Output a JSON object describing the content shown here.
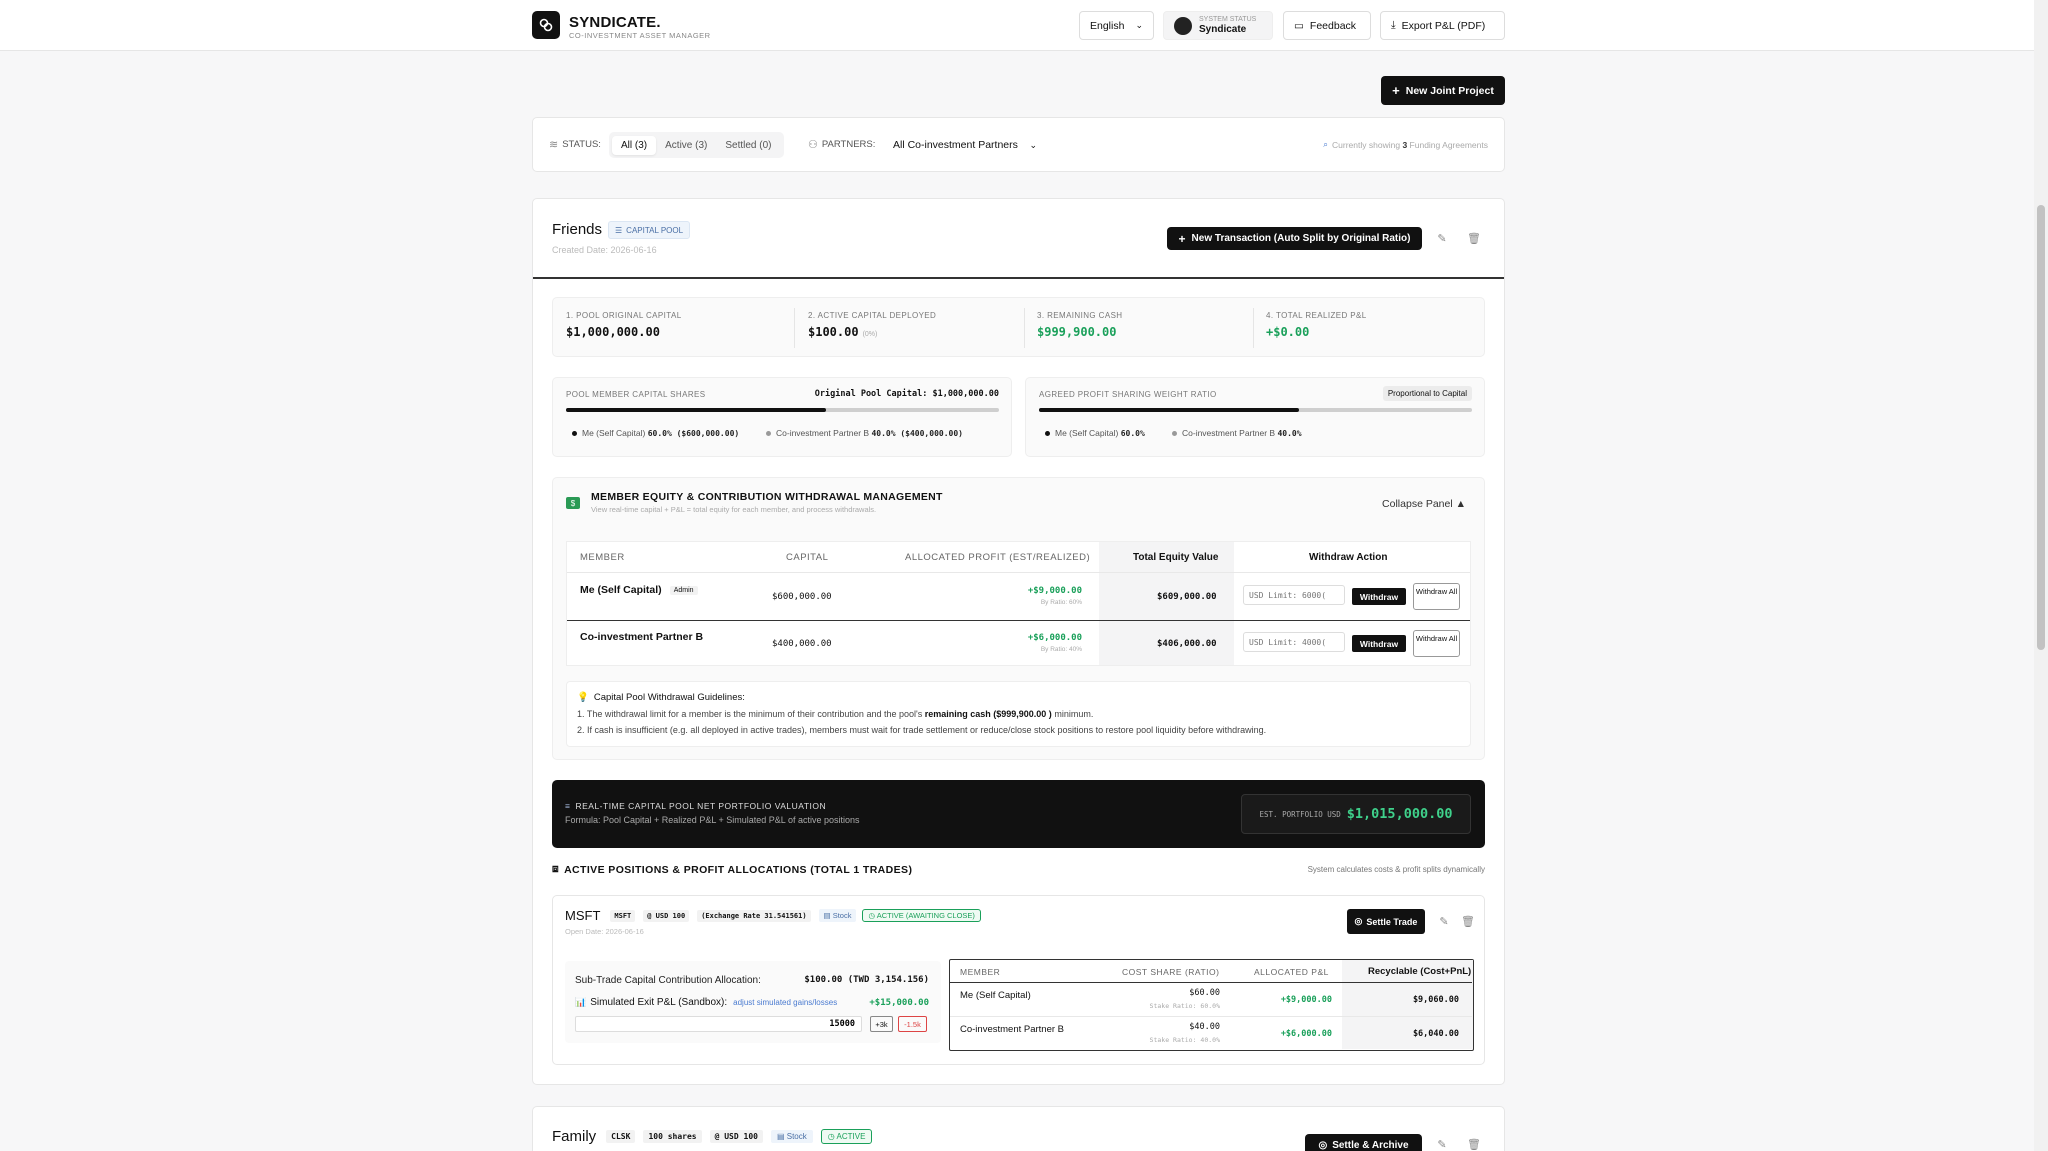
{
  "header": {
    "brand": "SYNDICATE.",
    "brand_sub": "CO-INVESTMENT ASSET MANAGER",
    "language": "English",
    "system_status_label": "SYSTEM STATUS",
    "system_status_value": "Syndicate",
    "feedback": "Feedback",
    "export": "Export P&L (PDF)"
  },
  "actions": {
    "new_project": "New Joint Project"
  },
  "filters": {
    "status_label": "STATUS:",
    "tabs": [
      "All (3)",
      "Active (3)",
      "Settled (0)"
    ],
    "partners_label": "PARTNERS:",
    "partners_value": "All Co-investment Partners",
    "showing_prefix": "Currently showing",
    "showing_count": "3",
    "showing_suffix": "Funding Agreements"
  },
  "friends": {
    "title": "Friends",
    "badge": "CAPITAL POOL",
    "created": "Created Date: 2026-06-16",
    "new_tx": "New Transaction (Auto Split by Original Ratio)",
    "stats": [
      {
        "label": "1. POOL ORIGINAL CAPITAL",
        "value": "$1,000,000.00",
        "note": ""
      },
      {
        "label": "2. ACTIVE CAPITAL DEPLOYED",
        "value": "$100.00",
        "note": "(0%)"
      },
      {
        "label": "3. REMAINING CASH",
        "value": "$999,900.00",
        "note": ""
      },
      {
        "label": "4. TOTAL REALIZED P&L",
        "value": "+$0.00",
        "note": ""
      }
    ],
    "shares": {
      "title": "POOL MEMBER CAPITAL SHARES",
      "original": "Original Pool Capital: $1,000,000.00",
      "fill": 0.6,
      "items": [
        {
          "name": "Me (Self Capital)",
          "value": "60.0% ($600,000.00)"
        },
        {
          "name": "Co-investment Partner B",
          "value": "40.0% ($400,000.00)"
        }
      ]
    },
    "weights": {
      "title": "AGREED PROFIT SHARING WEIGHT RATIO",
      "badge": "Proportional to Capital",
      "fill": 0.6,
      "items": [
        {
          "name": "Me (Self Capital)",
          "value": "60.0%"
        },
        {
          "name": "Co-investment Partner B",
          "value": "40.0%"
        }
      ]
    },
    "equity": {
      "title": "MEMBER EQUITY & CONTRIBUTION WITHDRAWAL MANAGEMENT",
      "subtitle": "View real-time capital + P&L = total equity for each member, and process withdrawals.",
      "collapse": "Collapse Panel ▲",
      "headers": [
        "MEMBER",
        "CAPITAL",
        "ALLOCATED PROFIT (EST/REALIZED)",
        "Total Equity Value",
        "Withdraw Action"
      ],
      "rows": [
        {
          "member": "Me (Self Capital)",
          "tag": "Admin",
          "capital": "$600,000.00",
          "profit": "+$9,000.00",
          "ratio": "By Ratio: 60%",
          "equity": "$609,000.00",
          "placeholder": "USD Limit: 6000(",
          "withdraw": "Withdraw",
          "withdraw_all": "Withdraw All"
        },
        {
          "member": "Co-investment Partner B",
          "tag": "",
          "capital": "$400,000.00",
          "profit": "+$6,000.00",
          "ratio": "By Ratio: 40%",
          "equity": "$406,000.00",
          "placeholder": "USD Limit: 4000(",
          "withdraw": "Withdraw",
          "withdraw_all": "Withdraw All"
        }
      ],
      "guidelines_title": "Capital Pool Withdrawal Guidelines:",
      "g1_a": "1. The withdrawal limit for a member is the minimum of their contribution and the pool's",
      "g1_b": "remaining cash ($999,900.00 )",
      "g1_c": "minimum.",
      "g2": "2. If cash is insufficient (e.g. all deployed in active trades), members must wait for trade settlement or reduce/close stock positions to restore pool liquidity before withdrawing."
    },
    "valuation": {
      "title": "REAL-TIME CAPITAL POOL NET PORTFOLIO VALUATION",
      "formula": "Formula: Pool Capital + Realized P&L + Simulated P&L of active positions",
      "est_label": "EST. PORTFOLIO USD",
      "est_value": "$1,015,000.00"
    },
    "positions": {
      "title": "ACTIVE POSITIONS & PROFIT ALLOCATIONS (TOTAL 1 TRADES)",
      "note": "System calculates costs & profit splits dynamically",
      "trade": {
        "ticker": "MSFT",
        "tag_ticker": "MSFT",
        "price": "@ USD 100",
        "rate": "(Exchange Rate 31.541561)",
        "type": "Stock",
        "status": "ACTIVE (AWAITING CLOSE)",
        "open_date": "Open Date: 2026-06-16",
        "settle": "Settle Trade",
        "alloc_label": "Sub-Trade Capital Contribution Allocation:",
        "alloc_value": "$100.00 (TWD 3,154.156)",
        "sim_label": "Simulated Exit P&L (Sandbox):",
        "sim_link": "adjust simulated gains/losses",
        "sim_value": "+$15,000.00",
        "sim_input": "15000",
        "plus": "+3k",
        "minus": "-1.5k",
        "headers": [
          "MEMBER",
          "COST SHARE (RATIO)",
          "ALLOCATED P&L",
          "Recyclable (Cost+PnL)"
        ],
        "rows": [
          {
            "member": "Me (Self Capital)",
            "cost": "$60.00",
            "stake": "Stake Ratio: 60.0%",
            "pnl": "+$9,000.00",
            "recyclable": "$9,060.00"
          },
          {
            "member": "Co-investment Partner B",
            "cost": "$40.00",
            "stake": "Stake Ratio: 40.0%",
            "pnl": "+$6,000.00",
            "recyclable": "$6,040.00"
          }
        ]
      }
    }
  },
  "family": {
    "title": "Family",
    "ticker": "CLSK",
    "shares": "100 shares",
    "price": "@ USD 100",
    "type": "Stock",
    "status": "ACTIVE",
    "settle": "Settle & Archive"
  },
  "colors": {
    "accent_green": "#1aa05a",
    "dark": "#111111"
  }
}
